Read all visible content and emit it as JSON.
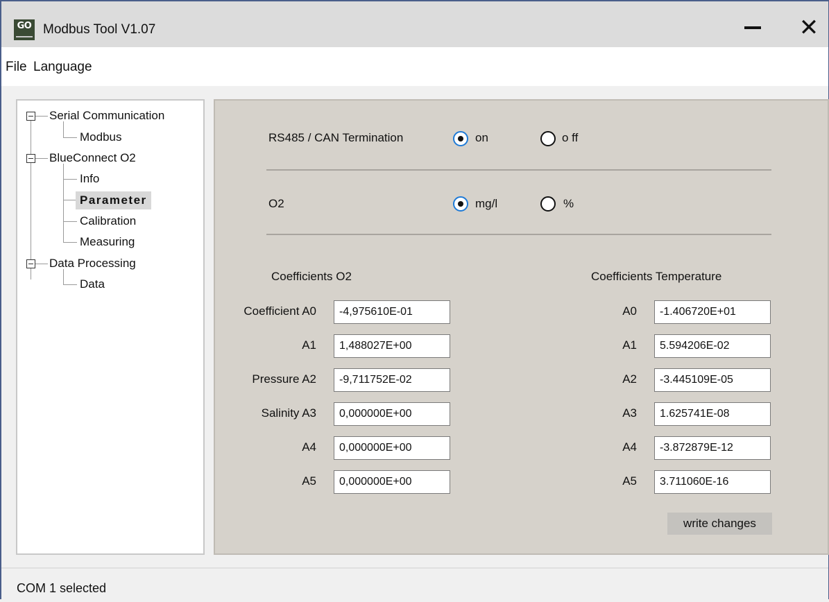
{
  "window": {
    "title": "Modbus Tool V1.07",
    "logo_text": "GO",
    "minimize_icon": "minimize-icon",
    "close_icon": "close-icon"
  },
  "menu": [
    "File",
    "Language"
  ],
  "tree": {
    "serial": "Serial Communication",
    "modbus": "Modbus",
    "blueconnect": "BlueConnect O2",
    "info": "Info",
    "parameter": "Parameter",
    "calibration": "Calibration",
    "measuring": "Measuring",
    "data_processing": "Data Processing",
    "data": "Data"
  },
  "termination": {
    "label": "RS485 / CAN Termination",
    "on_label": "on",
    "off_label": "o ff",
    "selected": "on"
  },
  "o2_unit": {
    "label": "O2",
    "mgl_label": "mg/l",
    "percent_label": "%",
    "selected": "mg/l"
  },
  "coeff_o2": {
    "heading": "Coefficients O2",
    "rows": [
      {
        "label": "Coefficient A0",
        "value": "-4,975610E-01"
      },
      {
        "label": "A1",
        "value": "1,488027E+00"
      },
      {
        "label": "Pressure A2",
        "value": "-9,711752E-02"
      },
      {
        "label": "Salinity A3",
        "value": "0,000000E+00"
      },
      {
        "label": "A4",
        "value": "0,000000E+00"
      },
      {
        "label": "A5",
        "value": "0,000000E+00"
      }
    ]
  },
  "coeff_temp": {
    "heading": "Coefficients Temperature",
    "rows": [
      {
        "label": "A0",
        "value": "-1.406720E+01"
      },
      {
        "label": "A1",
        "value": "5.594206E-02"
      },
      {
        "label": "A2",
        "value": "-3.445109E-05"
      },
      {
        "label": "A3",
        "value": "1.625741E-08"
      },
      {
        "label": "A4",
        "value": "-3.872879E-12"
      },
      {
        "label": "A5",
        "value": "3.711060E-16"
      }
    ]
  },
  "write_button": "write changes",
  "status": "COM 1 selected",
  "colors": {
    "panel_bg": "#d6d2cb",
    "radio_accent": "#1e7ad6",
    "frame_border": "#4a5e8a"
  }
}
